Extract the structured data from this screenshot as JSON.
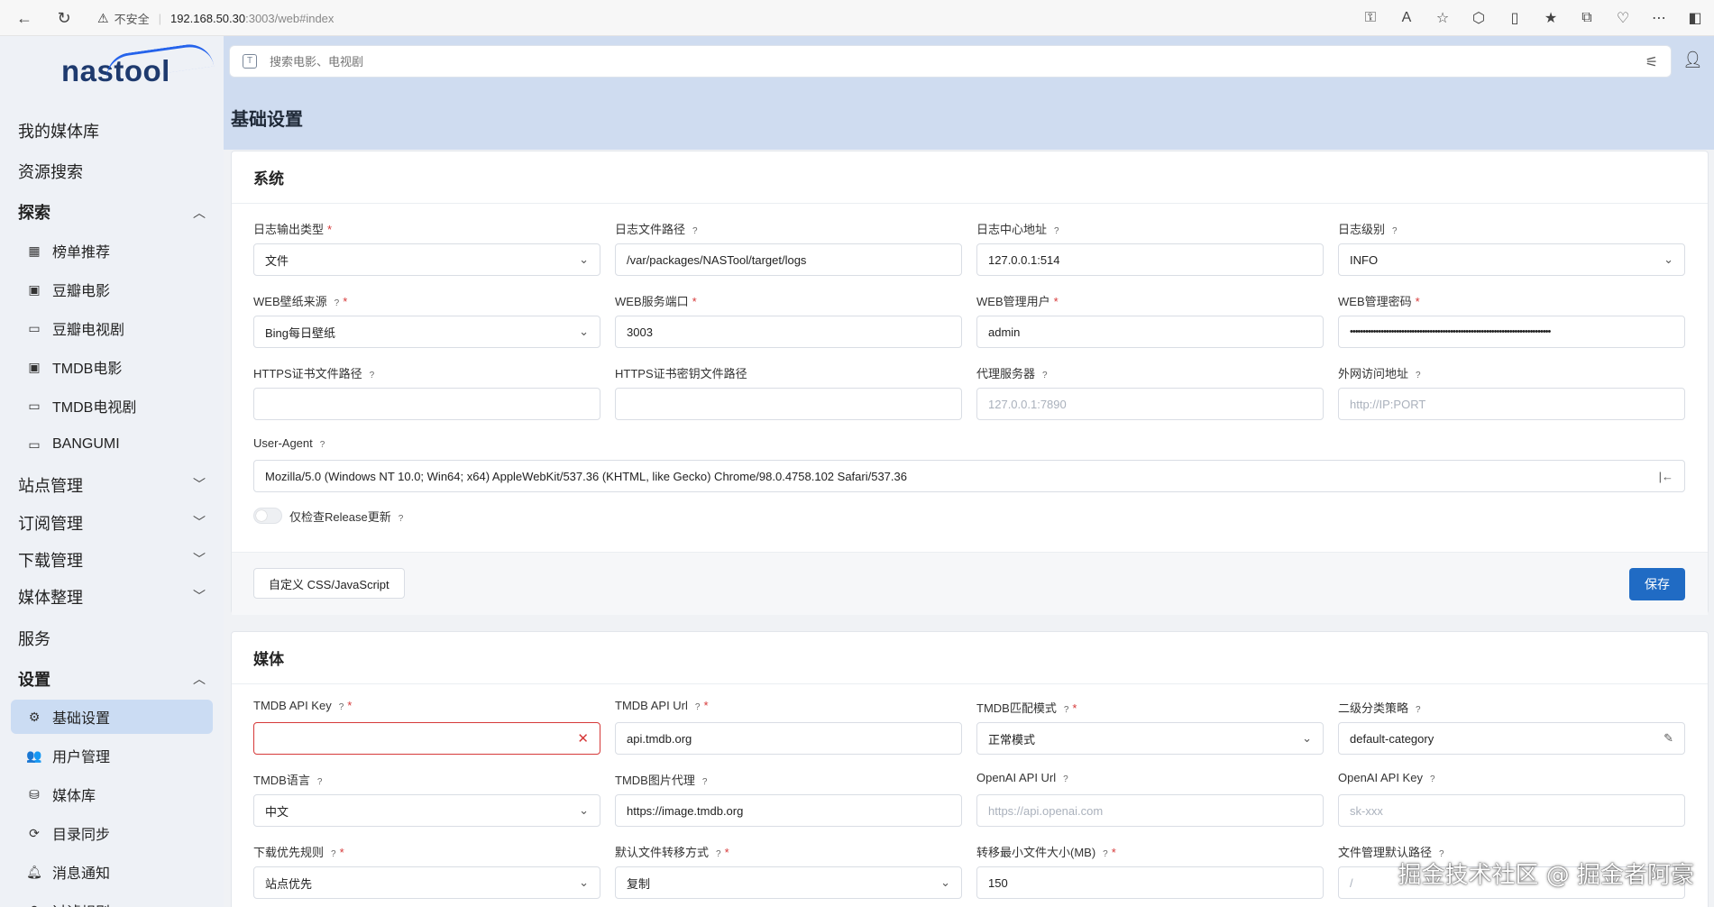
{
  "browser": {
    "insecure": "不安全",
    "host": "192.168.50.30",
    "path": ":3003/web#index"
  },
  "sidebar": {
    "logo": "nastool",
    "top_items": [
      "我的媒体库",
      "资源搜索"
    ],
    "explore": {
      "label": "探索",
      "items": [
        "榜单推荐",
        "豆瓣电影",
        "豆瓣电视剧",
        "TMDB电影",
        "TMDB电视剧",
        "BANGUMI"
      ]
    },
    "groups": [
      "站点管理",
      "订阅管理",
      "下载管理",
      "媒体整理"
    ],
    "service": "服务",
    "settings": {
      "label": "设置",
      "items": [
        "基础设置",
        "用户管理",
        "媒体库",
        "目录同步",
        "消息通知",
        "过滤规则"
      ]
    }
  },
  "search": {
    "placeholder": "搜索电影、电视剧"
  },
  "page_title": "基础设置",
  "system": {
    "title": "系统",
    "log_type": {
      "label": "日志输出类型",
      "value": "文件"
    },
    "log_path": {
      "label": "日志文件路径",
      "value": "/var/packages/NASTool/target/logs"
    },
    "log_center": {
      "label": "日志中心地址",
      "value": "127.0.0.1:514"
    },
    "log_level": {
      "label": "日志级别",
      "value": "INFO"
    },
    "wallpaper": {
      "label": "WEB壁纸来源",
      "value": "Bing每日壁纸"
    },
    "web_port": {
      "label": "WEB服务端口",
      "value": "3003"
    },
    "web_user": {
      "label": "WEB管理用户",
      "value": "admin"
    },
    "web_pass": {
      "label": "WEB管理密码",
      "value": "••••••••••••••••••••••••••••••••••••••••••••••••••••••••••••••••••••••••••••••"
    },
    "https_cert": {
      "label": "HTTPS证书文件路径",
      "value": ""
    },
    "https_key": {
      "label": "HTTPS证书密钥文件路径",
      "value": ""
    },
    "proxy": {
      "label": "代理服务器",
      "placeholder": "127.0.0.1:7890"
    },
    "external": {
      "label": "外网访问地址",
      "placeholder": "http://IP:PORT"
    },
    "ua": {
      "label": "User-Agent",
      "value": "Mozilla/5.0 (Windows NT 10.0; Win64; x64) AppleWebKit/537.36 (KHTML, like Gecko) Chrome/98.0.4758.102 Safari/537.36"
    },
    "release_check": "仅检查Release更新",
    "custom_btn": "自定义 CSS/JavaScript",
    "save_btn": "保存"
  },
  "media": {
    "title": "媒体",
    "tmdb_key": {
      "label": "TMDB API Key",
      "value": ""
    },
    "tmdb_url": {
      "label": "TMDB API Url",
      "value": "api.tmdb.org"
    },
    "tmdb_match": {
      "label": "TMDB匹配模式",
      "value": "正常模式"
    },
    "category": {
      "label": "二级分类策略",
      "value": "default-category"
    },
    "tmdb_lang": {
      "label": "TMDB语言",
      "value": "中文"
    },
    "tmdb_img": {
      "label": "TMDB图片代理",
      "value": "https://image.tmdb.org"
    },
    "openai_url": {
      "label": "OpenAI API Url",
      "placeholder": "https://api.openai.com"
    },
    "openai_key": {
      "label": "OpenAI API Key",
      "placeholder": "sk-xxx"
    },
    "dl_priority": {
      "label": "下载优先规则",
      "value": "站点优先"
    },
    "transfer": {
      "label": "默认文件转移方式",
      "value": "复制"
    },
    "min_size": {
      "label": "转移最小文件大小(MB)",
      "value": "150"
    },
    "fm_path": {
      "label": "文件管理默认路径",
      "placeholder": "/"
    }
  },
  "watermark": "掘金技术社区 @ 掘金者阿豪"
}
